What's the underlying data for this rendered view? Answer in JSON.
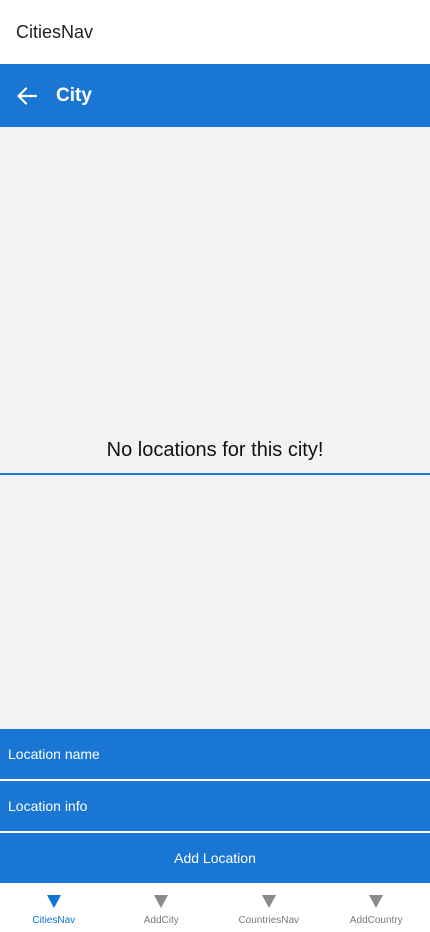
{
  "app": {
    "title": "CitiesNav"
  },
  "nav": {
    "title": "City"
  },
  "content": {
    "empty_message": "No locations for this city!"
  },
  "form": {
    "location_name_placeholder": "Location name",
    "location_info_placeholder": "Location info",
    "add_label": "Add Location"
  },
  "tabs": [
    {
      "label": "CitiesNav",
      "active": true
    },
    {
      "label": "AddCity",
      "active": false
    },
    {
      "label": "CountriesNav",
      "active": false
    },
    {
      "label": "AddCountry",
      "active": false
    }
  ],
  "colors": {
    "primary": "#1976d2",
    "active_tab": "#1173d4",
    "inactive_tab": "#8a8a8a",
    "background": "#f2f2f2"
  }
}
